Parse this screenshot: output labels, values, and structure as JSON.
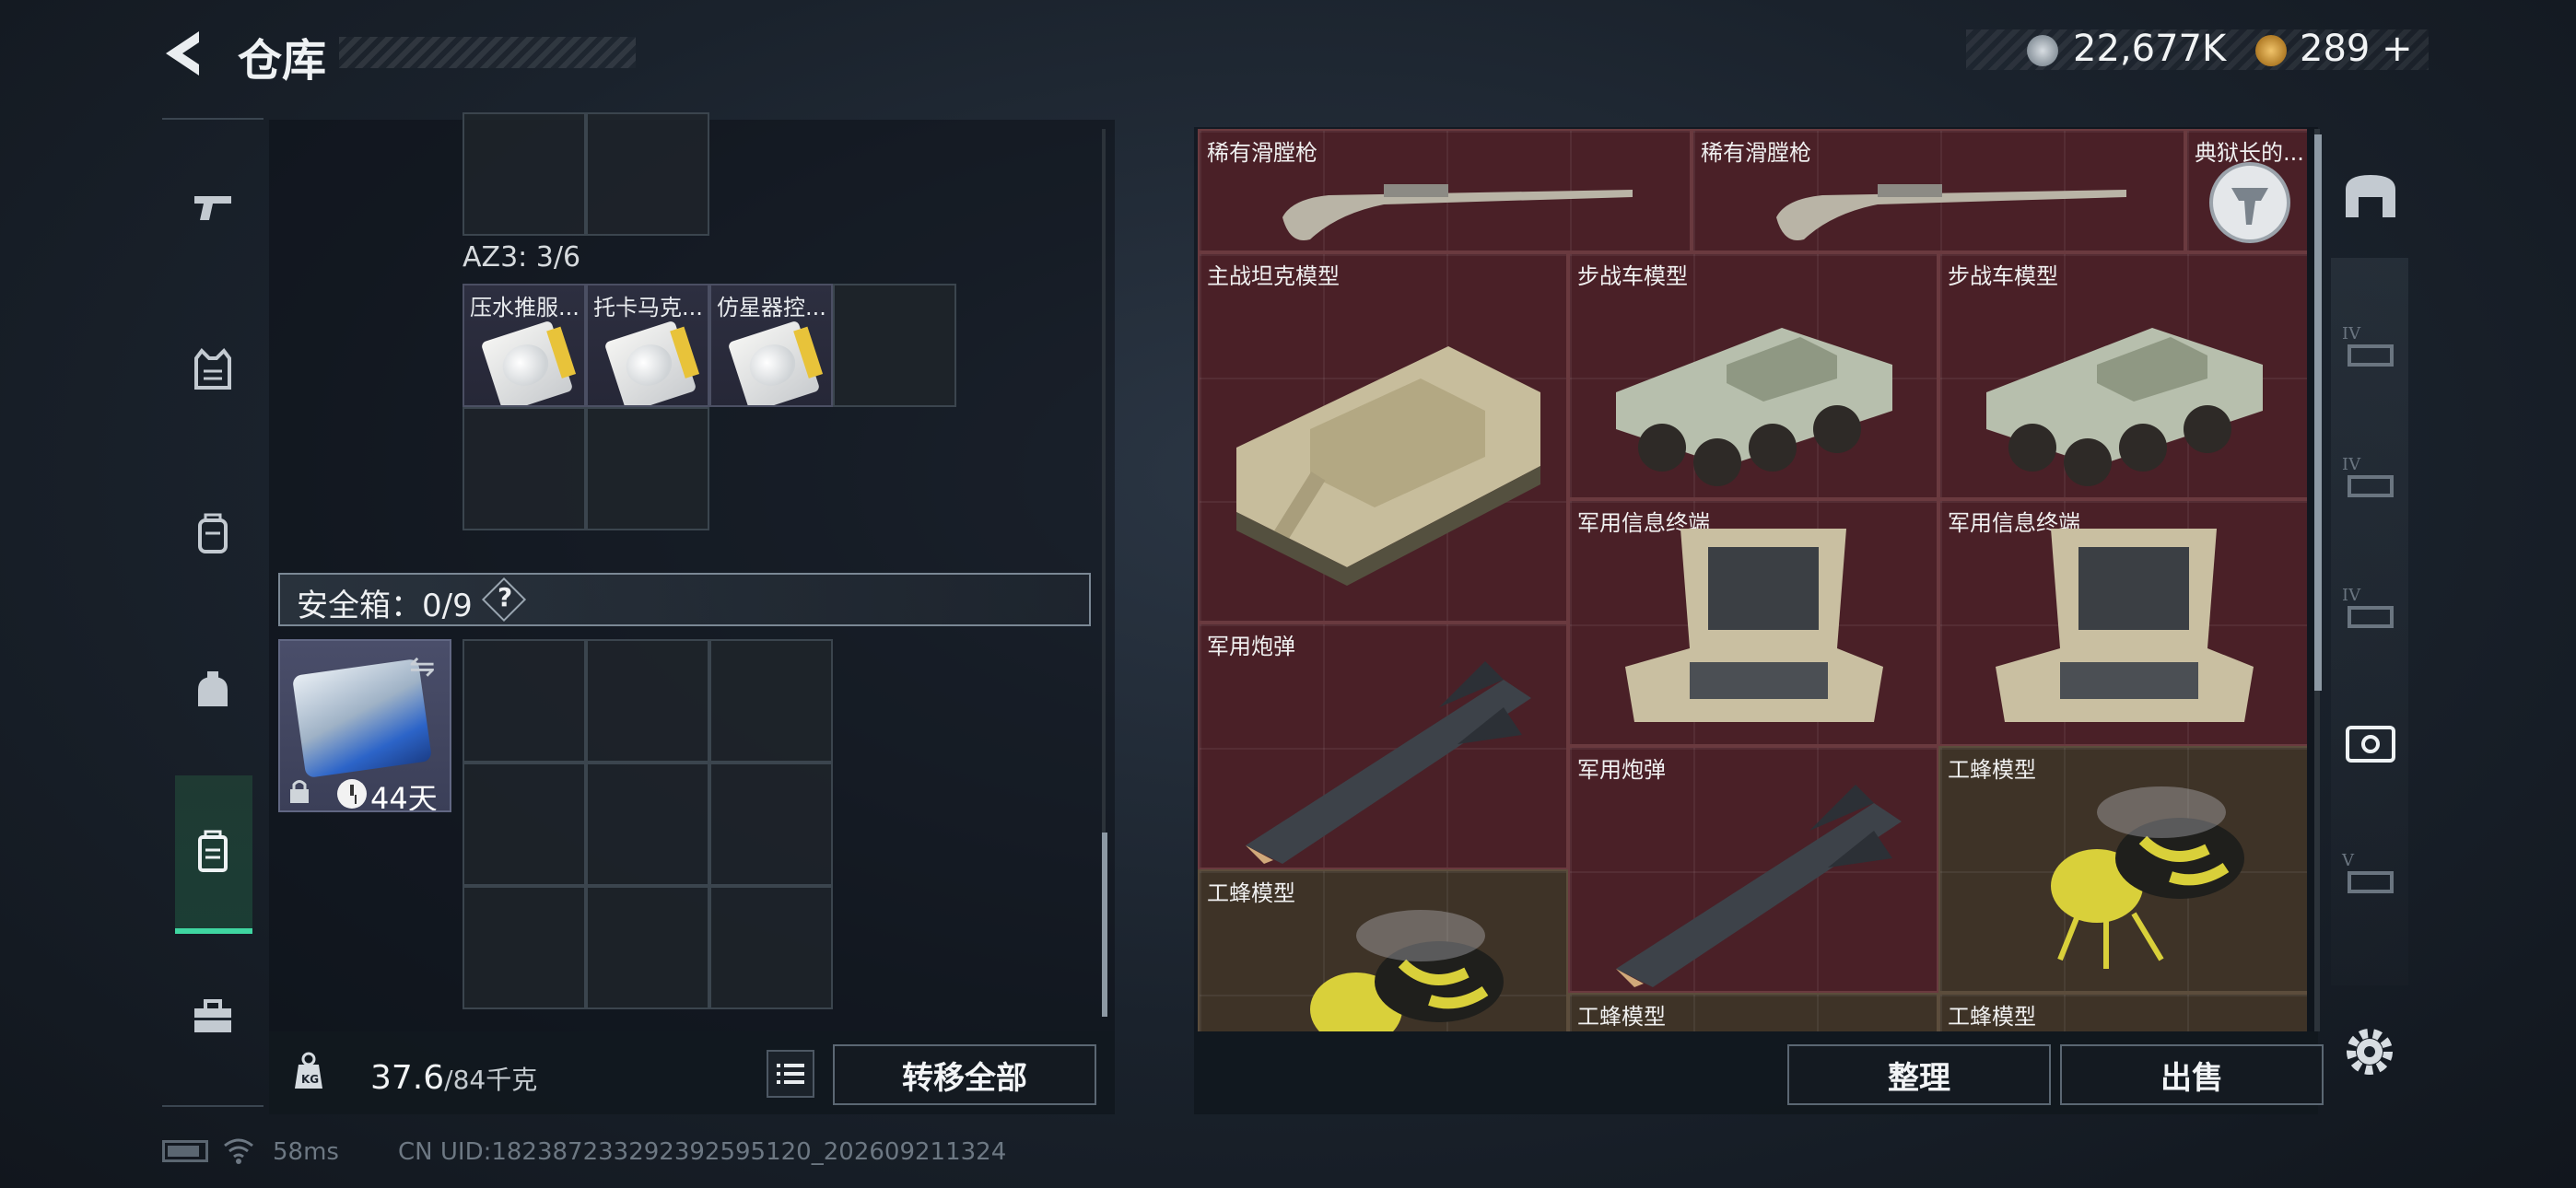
{
  "header": {
    "title": "仓库",
    "silver_amount": "22,677K",
    "gold_amount": "289",
    "gold_plus": "+"
  },
  "left_sidebar": {
    "items": [
      {
        "name": "weapons"
      },
      {
        "name": "armor"
      },
      {
        "name": "backpack"
      },
      {
        "name": "helmet-bag"
      },
      {
        "name": "container",
        "active": true
      },
      {
        "name": "toolbox"
      }
    ],
    "accent_color": "#3fd6a1"
  },
  "stash": {
    "container_label": "AZ3: 3/6",
    "items": [
      {
        "name": "压水推服..."
      },
      {
        "name": "托卡马克..."
      },
      {
        "name": "仿星器控..."
      }
    ],
    "safe_label": "安全箱：0/9",
    "safe_help": "?",
    "safebox_days": "44天",
    "weight_value": "37.6",
    "weight_max": "/84千克",
    "transfer_all": "转移全部"
  },
  "warehouse": {
    "tiles": [
      {
        "name": "稀有滑膛枪",
        "color": "red"
      },
      {
        "name": "稀有滑膛枪",
        "color": "red"
      },
      {
        "name": "典狱长的...",
        "color": "red"
      },
      {
        "name": "主战坦克模型",
        "color": "red"
      },
      {
        "name": "步战车模型",
        "color": "red"
      },
      {
        "name": "步战车模型",
        "color": "red"
      },
      {
        "name": "军用信息终端",
        "color": "red"
      },
      {
        "name": "军用信息终端",
        "color": "red"
      },
      {
        "name": "军用炮弹",
        "color": "red"
      },
      {
        "name": "军用炮弹",
        "color": "red"
      },
      {
        "name": "工蜂模型",
        "color": "olive"
      },
      {
        "name": "工蜂模型",
        "color": "olive"
      },
      {
        "name": "工蜂模型",
        "color": "olive"
      },
      {
        "name": "工蜂模型",
        "color": "olive"
      }
    ],
    "sort_label": "整理",
    "sell_label": "出售"
  },
  "right_sidebar": {
    "tier_labels": [
      "IV",
      "IV",
      "IV",
      "V"
    ]
  },
  "status": {
    "ping": "58ms",
    "uid": "CN UID:1823872332923925951​20_202609211324"
  }
}
